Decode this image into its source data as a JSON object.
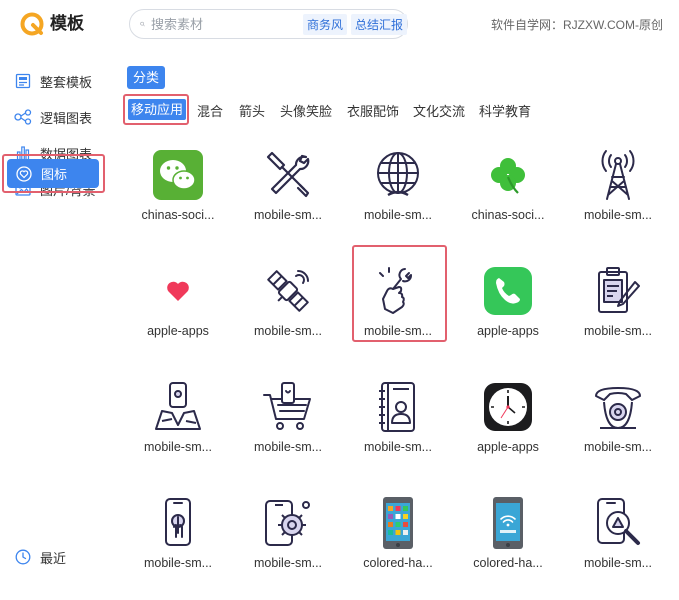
{
  "header": {
    "logo_text": "模板",
    "search": {
      "placeholder": "搜索素材",
      "tags": [
        "商务风",
        "总结汇报"
      ]
    },
    "site_note": "软件自学网：RJZXW.COM-原创"
  },
  "sidebar": {
    "items": [
      {
        "label": "整套模板",
        "icon": "template-grid-icon"
      },
      {
        "label": "逻辑图表",
        "icon": "logic-diagram-icon"
      },
      {
        "label": "数据图表",
        "icon": "bar-chart-icon"
      },
      {
        "label": "图片/背景",
        "icon": "image-icon"
      },
      {
        "label": "图标",
        "icon": "heart-badge-icon",
        "active": true
      }
    ],
    "recent_label": "最近"
  },
  "category": {
    "title": "分类",
    "subtabs": [
      "移动应用",
      "混合",
      "箭头",
      "头像笑脸",
      "衣服配饰",
      "文化交流",
      "科学教育"
    ],
    "active_subtab": "移动应用"
  },
  "colors": {
    "accent": "#3d85ee",
    "highlight_border": "#e2606e",
    "logo_orange": "#f5a623",
    "line_icon": "#2c2a4a"
  },
  "grid": {
    "rows": [
      [
        {
          "label": "chinas-soci...",
          "icon": "wechat-icon"
        },
        {
          "label": "mobile-sm...",
          "icon": "wrench-screwdriver-icon"
        },
        {
          "label": "mobile-sm...",
          "icon": "globe-icon"
        },
        {
          "label": "chinas-soci...",
          "icon": "clover-icon"
        },
        {
          "label": "mobile-sm...",
          "icon": "signal-tower-icon"
        }
      ],
      [
        {
          "label": "apple-apps",
          "icon": "heart-icon"
        },
        {
          "label": "mobile-sm...",
          "icon": "satellite-icon"
        },
        {
          "label": "mobile-sm...",
          "icon": "hand-wrench-icon",
          "selected": true
        },
        {
          "label": "apple-apps",
          "icon": "phone-app-icon"
        },
        {
          "label": "mobile-sm...",
          "icon": "clipboard-pen-icon"
        }
      ],
      [
        {
          "label": "mobile-sm...",
          "icon": "phone-map-icon"
        },
        {
          "label": "mobile-sm...",
          "icon": "shopping-cart-icon"
        },
        {
          "label": "mobile-sm...",
          "icon": "address-book-icon"
        },
        {
          "label": "apple-apps",
          "icon": "clock-app-icon"
        },
        {
          "label": "mobile-sm...",
          "icon": "rotary-phone-icon"
        }
      ],
      [
        {
          "label": "mobile-sm...",
          "icon": "phone-touch-icon"
        },
        {
          "label": "mobile-sm...",
          "icon": "phone-gear-icon"
        },
        {
          "label": "colored-ha...",
          "icon": "colored-phone-apps-icon"
        },
        {
          "label": "colored-ha...",
          "icon": "colored-phone-wifi-icon"
        },
        {
          "label": "mobile-sm...",
          "icon": "phone-search-icon"
        }
      ]
    ]
  }
}
